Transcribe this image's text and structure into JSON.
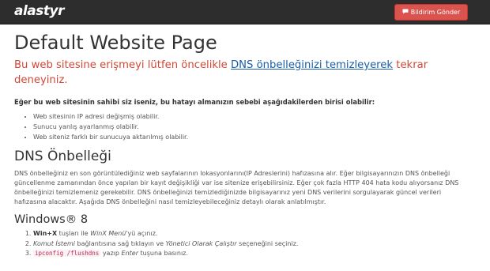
{
  "navbar": {
    "logo_text": "alastyr",
    "report_button": {
      "icon": "chat-icon",
      "label": "Bildirim Gönder"
    }
  },
  "main": {
    "title": "Default Website Page",
    "lead": {
      "text_before": "Bu web sitesine erişmeyi lütfen öncelikle ",
      "link_text": "DNS önbelleğinizi temizleyerek",
      "text_after": " tekrar deneyiniz."
    },
    "owner_note": "Eğer bu web sitesinin sahibi siz iseniz, bu hatayı almanızın sebebi aşağıdakilerden birisi olabilir:",
    "reasons": [
      "Web sitesinin IP adresi değişmiş olabilir.",
      "Sunucu yanlış ayarlanmış olabilir.",
      "Web siteniz farklı bir sunucuya aktarılmış olabilir."
    ],
    "dns_section": {
      "heading": "DNS Önbelleği",
      "paragraph": "DNS önbelleğiniz en son görüntülediğiniz web sayfalarının lokasyonlarını(IP Adreslerini) hafızasına alır. Eğer bilgisayarınızın DNS önbelleği güncellenme zamanından önce yapılan bir kayıt değişikliği var ise sitenize erişebilirsiniz. Eğer çok fazla HTTP 404 hata kodu alıyorsanız DNS önbelleğinizi temizlemeniz gerekebilir. DNS önbelleğinizi temizlediğinizde bilgisayarınız yeni DNS verilerini sorgulayarak güncel verileri hafızasına alacaktır. Aşağıda DNS önbelleğini nasıl temizleyebileceğiniz detaylı olarak anlatılmıştır."
    },
    "windows8": {
      "heading": "Windows® 8",
      "steps": [
        {
          "bold": "Win+X",
          "t1": " tuşları ile ",
          "italic": "WinX Menü",
          "t2": "'yü açınız."
        },
        {
          "italic": "Komut İstemi",
          "t1": " bağlantısına sağ tıklayın ve ",
          "italic2": "Yönetici Olarak Çalıştır",
          "t2": " seçeneğini seçiniz."
        },
        {
          "code": "ipconfig /flushdns",
          "t1": " yazıp ",
          "italic": "Enter",
          "t2": " tuşuna basınız."
        }
      ]
    }
  }
}
